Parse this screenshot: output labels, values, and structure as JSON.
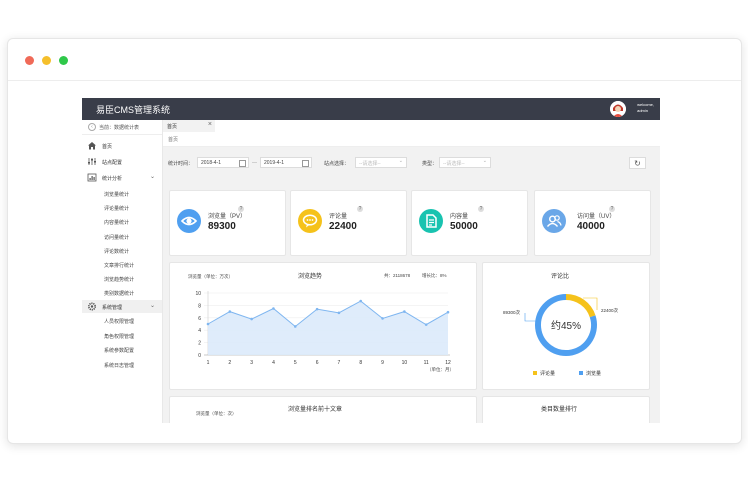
{
  "app": {
    "title": "易臣CMS管理系统",
    "user_greeting": "welcome,",
    "user_name": "admin"
  },
  "sidebar": {
    "breadcrumb": "当前：数据统计表",
    "items": [
      {
        "label": "首页",
        "icon": "home-icon"
      },
      {
        "label": "站点配置",
        "icon": "sliders-icon"
      },
      {
        "label": "统计分析",
        "icon": "chart-icon"
      },
      {
        "label": "系统管理",
        "icon": "gear-icon"
      }
    ],
    "stats_sub": [
      "浏览量统计",
      "评论量统计",
      "内容量统计",
      "访问量统计",
      "评论数统计",
      "文章排行统计",
      "浏览趋势统计",
      "类别数据统计"
    ],
    "sys_sub": [
      "人员权限管理",
      "角色权限管理",
      "系统参数配置",
      "系统日志管理"
    ]
  },
  "tabs": [
    {
      "label": "首页"
    }
  ],
  "subcrumb": "首页",
  "filters": {
    "time_label": "统计时间：",
    "date_start": "2018-4-1",
    "sep": "—",
    "date_end": "2019-4-1",
    "site_label": "站点选择：",
    "site_placeholder": "--请选择--",
    "type_label": "类型：",
    "type_placeholder": "--请选择--"
  },
  "stats": [
    {
      "label": "浏览量（PV）",
      "value": "89300",
      "color": "#4f9ff0",
      "icon": "eye-icon"
    },
    {
      "label": "评论量",
      "value": "22400",
      "color": "#f5c21b",
      "icon": "comment-icon"
    },
    {
      "label": "内容量",
      "value": "50000",
      "color": "#19c3b0",
      "icon": "document-icon"
    },
    {
      "label": "访问量（UV）",
      "value": "40000",
      "color": "#6aa7e8",
      "icon": "users-icon"
    }
  ],
  "chart_data": [
    {
      "type": "area",
      "title": "浏览趋势",
      "ylabel": "浏览量（单位：万次）",
      "xlabel": "（单位：月）",
      "summary": "共：2118678",
      "growth": "增长比：8%",
      "x": [
        1,
        2,
        3,
        4,
        5,
        6,
        7,
        8,
        9,
        10,
        11,
        12
      ],
      "values": [
        5,
        7,
        5.8,
        7.5,
        4.6,
        7.4,
        6.8,
        8.7,
        5.9,
        7,
        4.9,
        6.9
      ],
      "ylim": [
        0,
        10
      ],
      "yticks": [
        0,
        2,
        4,
        6,
        8,
        10
      ],
      "color": "#7fb6f0",
      "grid": true
    },
    {
      "type": "pie",
      "title": "评论比",
      "center_label": "约45%",
      "categories": [
        "评论量",
        "浏览量"
      ],
      "callouts": [
        "22400次",
        "89300次"
      ],
      "share": [
        0.2,
        0.8
      ],
      "colors": [
        "#f5c21b",
        "#4f9ff0"
      ],
      "legend": "bottom"
    }
  ],
  "bottom": {
    "ranking_title": "浏览量排名前十文章",
    "ranking_unit": "浏览量（单位：次）",
    "category_title": "类目数量排行"
  }
}
